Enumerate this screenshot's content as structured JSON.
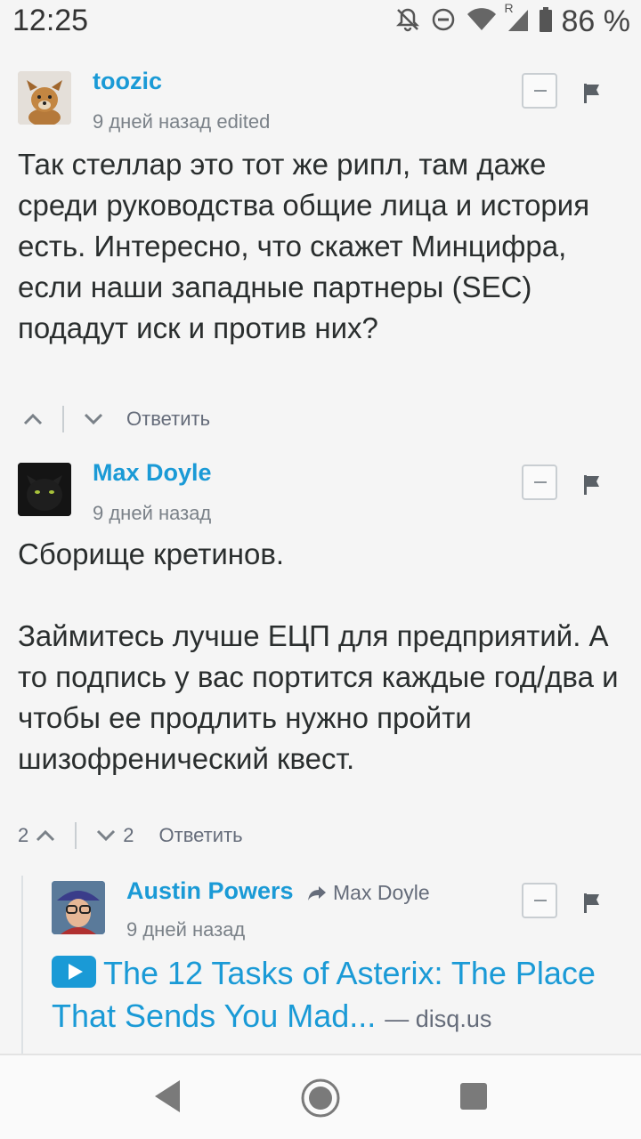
{
  "status_bar": {
    "time": "12:25",
    "battery_percent": "86 %",
    "network_label": "R",
    "icons": [
      "notifications-off-icon",
      "dnd-icon",
      "wifi-icon",
      "signal-icon",
      "battery-icon"
    ]
  },
  "comments": [
    {
      "author": "toozic",
      "meta": "9 дней назад edited",
      "avatar": "dog-avatar",
      "paragraphs": [
        "Так стеллар это тот же рипл, там даже среди руководства общие лица и история есть. Интересно, что скажет Минцифра, если наши западные партнеры (SEC) подадут иск и против них?"
      ],
      "upvotes": "",
      "downvotes": "",
      "reply_label": "Ответить"
    },
    {
      "author": "Max Doyle",
      "meta": "9 дней назад",
      "avatar": "cat-avatar",
      "paragraphs": [
        "Сборище кретинов.",
        "Займитесь лучше ЕЦП для предприятий. А то подпись у вас портится каждые год/два и чтобы ее продлить нужно пройти шизофренический квест."
      ],
      "upvotes": "2",
      "downvotes": "2",
      "reply_label": "Ответить"
    },
    {
      "author": "Austin Powers",
      "reply_to": "Max Doyle",
      "meta": "9 дней назад",
      "avatar": "austin-avatar",
      "link_text": "The 12 Tasks of Asterix: The Place That Sends You Mad...",
      "link_domain": "— disq.us"
    }
  ],
  "colors": {
    "accent": "#1a9ad6",
    "text": "#2a2e2e",
    "muted": "#656c7a",
    "background": "#f5f5f5"
  }
}
